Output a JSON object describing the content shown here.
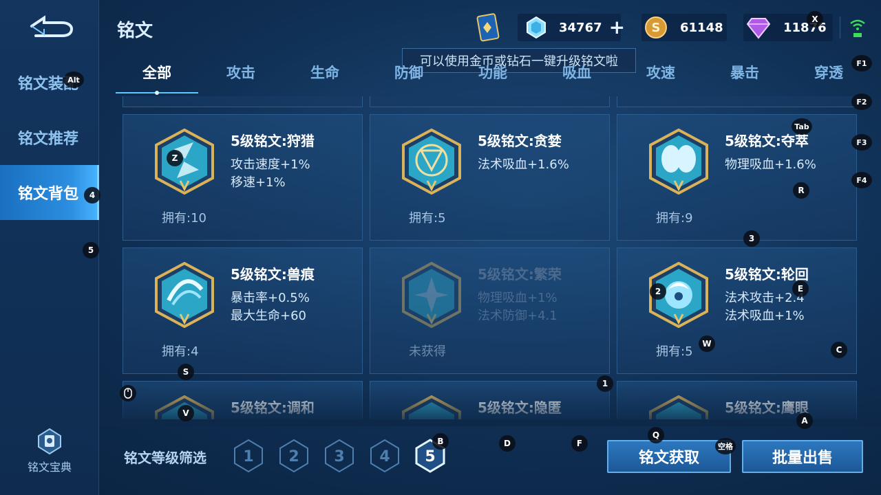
{
  "header": {
    "title": "铭文",
    "gold": "61148",
    "crystal": "34767",
    "diamond": "11876",
    "tip": "可以使用金币或钻石一键升级铭文啦"
  },
  "sidebar": {
    "items": [
      {
        "label": "铭文装配"
      },
      {
        "label": "铭文推荐"
      },
      {
        "label": "铭文背包"
      }
    ],
    "codex_label": "铭文宝典"
  },
  "tabs": [
    {
      "label": "全部"
    },
    {
      "label": "攻击"
    },
    {
      "label": "生命"
    },
    {
      "label": "防御"
    },
    {
      "label": "功能"
    },
    {
      "label": "吸血"
    },
    {
      "label": "攻速"
    },
    {
      "label": "暴击"
    },
    {
      "label": "穿透"
    }
  ],
  "cards": [
    {
      "name": "5级铭文:狩猎",
      "stat1": "攻击速度+1%",
      "stat2": "移速+1%",
      "owned": "拥有:10",
      "color": "#2fb8d8"
    },
    {
      "name": "5级铭文:贪婪",
      "stat1": "法术吸血+1.6%",
      "stat2": "",
      "owned": "拥有:5",
      "color": "#2fb8d8"
    },
    {
      "name": "5级铭文:夺萃",
      "stat1": "物理吸血+1.6%",
      "stat2": "",
      "owned": "拥有:9",
      "color": "#2fb8d8"
    },
    {
      "name": "5级铭文:兽痕",
      "stat1": "暴击率+0.5%",
      "stat2": "最大生命+60",
      "owned": "拥有:4",
      "color": "#2fb8d8"
    },
    {
      "name": "5级铭文:繁荣",
      "stat1": "物理吸血+1%",
      "stat2": "法术防御+4.1",
      "owned": "未获得",
      "color": "#2fb8d8"
    },
    {
      "name": "5级铭文:轮回",
      "stat1": "法术攻击+2.4",
      "stat2": "法术吸血+1%",
      "owned": "拥有:5",
      "color": "#2fb8d8"
    },
    {
      "name": "5级铭文:调和",
      "stat1": "",
      "stat2": "",
      "owned": "",
      "color": "#2fb8d8"
    },
    {
      "name": "5级铭文:隐匿",
      "stat1": "",
      "stat2": "",
      "owned": "",
      "color": "#2fb8d8"
    },
    {
      "name": "5级铭文:鹰眼",
      "stat1": "",
      "stat2": "",
      "owned": "",
      "color": "#2fb8d8"
    }
  ],
  "filter": {
    "label": "铭文等级筛选",
    "levels": [
      "1",
      "2",
      "3",
      "4",
      "5"
    ],
    "selected": "5"
  },
  "actions": {
    "obtain": "铭文获取",
    "bulk_sell": "批量出售"
  },
  "keys": [
    "X",
    "F1",
    "F2",
    "F3",
    "F4",
    "Alt",
    "Tab",
    "Z",
    "R",
    "3",
    "4",
    "5",
    "2",
    "E",
    "W",
    "C",
    "S",
    "1",
    "V",
    "A",
    "Q",
    "B",
    "D",
    "F",
    "空格"
  ]
}
